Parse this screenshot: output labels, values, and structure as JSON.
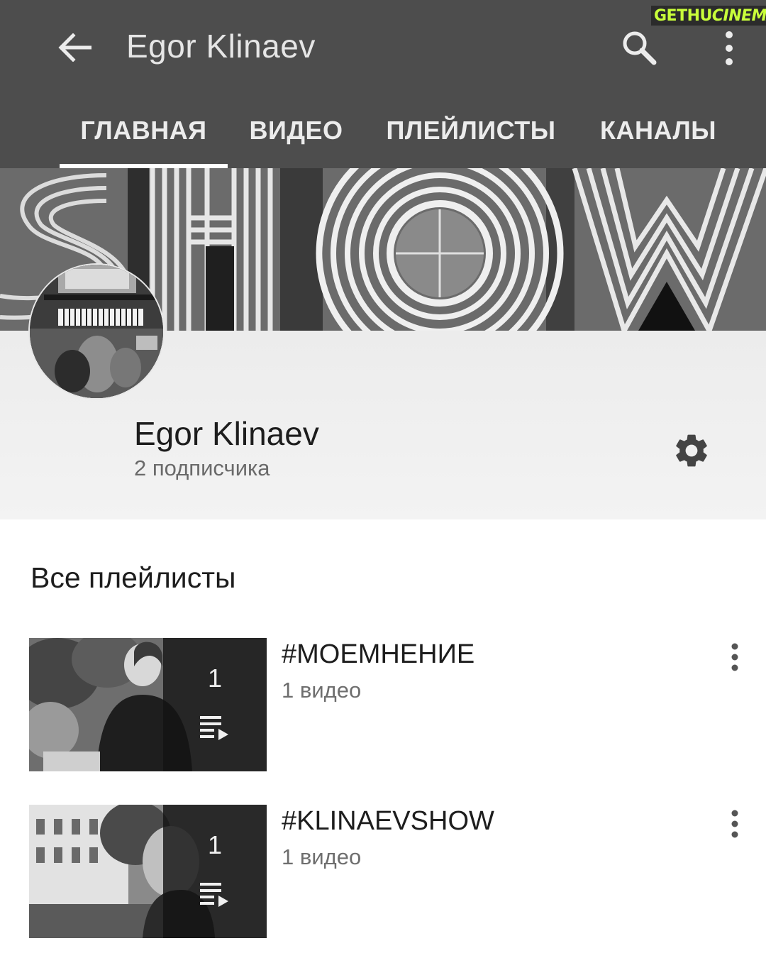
{
  "app_bar": {
    "title": "Egor Klinaev",
    "back_icon": "arrow-left-icon",
    "search_icon": "search-icon",
    "more_icon": "more-vertical-icon",
    "background": "#4d4d4d"
  },
  "watermark": {
    "part1": "GETHU",
    "part2": "CINEMA"
  },
  "tabs": [
    {
      "label": "ГЛАВНАЯ",
      "active": true
    },
    {
      "label": "ВИДЕО",
      "active": false
    },
    {
      "label": "ПЛЕЙЛИСТЫ",
      "active": false
    },
    {
      "label": "КАНАЛЫ",
      "active": false
    }
  ],
  "channel": {
    "name": "Egor Klinaev",
    "subscribers": "2 подписчика",
    "settings_icon": "gear-icon"
  },
  "playlists_section": {
    "title": "Все плейлисты",
    "items": [
      {
        "title": "#МОЕМНЕНИЕ",
        "meta": "1 видео",
        "count": "1"
      },
      {
        "title": "#KLINAEVSHOW",
        "meta": "1 видео",
        "count": "1"
      }
    ]
  }
}
